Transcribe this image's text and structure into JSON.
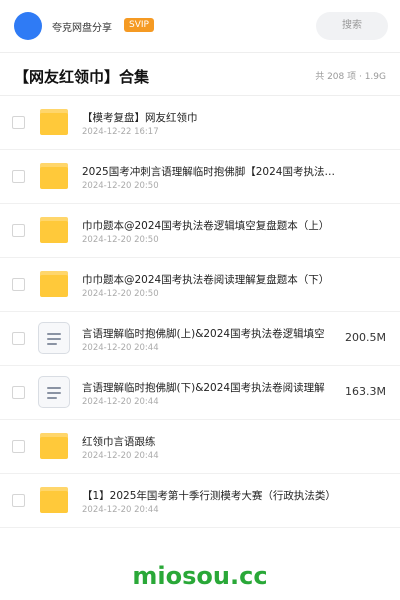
{
  "header": {
    "share_name": "夸克网盘分享",
    "badge": "SVIP",
    "search_label": "搜索"
  },
  "page": {
    "title": "【网友红领巾】合集",
    "meta": "共 208 项 · 1.9G"
  },
  "files": [
    {
      "name": "【模考复盘】网友红领巾",
      "date": "2024-12-22 16:17",
      "icon": "folder-icon",
      "size": ""
    },
    {
      "name": "2025国考冲刺言语理解临时抱佛脚【2024国考执法卷】",
      "date": "2024-12-20 20:50",
      "icon": "folder-icon",
      "size": ""
    },
    {
      "name": "巾巾题本@2024国考执法卷逻辑填空复盘题本（上）",
      "date": "2024-12-20 20:50",
      "icon": "folder-icon",
      "size": ""
    },
    {
      "name": "巾巾题本@2024国考执法卷阅读理解复盘题本（下）",
      "date": "2024-12-20 20:50",
      "icon": "folder-icon",
      "size": ""
    },
    {
      "name": "言语理解临时抱佛脚(上)&2024国考执法卷逻辑填空",
      "date": "2024-12-20 20:44",
      "icon": "document-icon",
      "size": "200.5M"
    },
    {
      "name": "言语理解临时抱佛脚(下)&2024国考执法卷阅读理解",
      "date": "2024-12-20 20:44",
      "icon": "document-icon",
      "size": "163.3M"
    },
    {
      "name": "红领巾言语跟练",
      "date": "2024-12-20 20:44",
      "icon": "folder-icon",
      "size": ""
    },
    {
      "name": "【1】2025年国考第十季行测模考大赛（行政执法类）",
      "date": "2024-12-20 20:44",
      "icon": "folder-icon",
      "size": ""
    }
  ],
  "watermark": "miosou.cc",
  "colors": {
    "avatar": "#2f7bf5",
    "badge": "#f59a23",
    "folder": "#ffc93a",
    "watermark": "#2aa838"
  }
}
